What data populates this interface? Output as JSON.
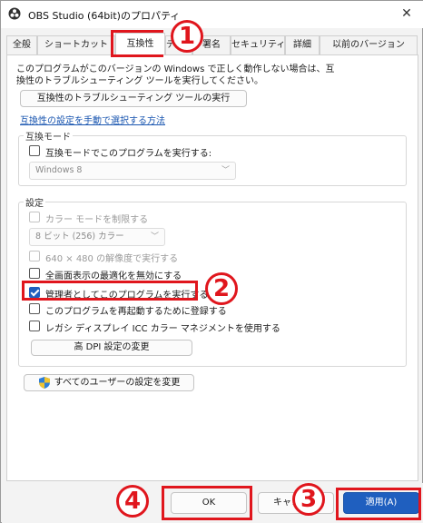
{
  "window": {
    "title": "OBS Studio (64bit)のプロパティ",
    "close_glyph": "✕"
  },
  "tabs": [
    {
      "label": "全般"
    },
    {
      "label": "ショートカット"
    },
    {
      "label": "互換性",
      "active": true
    },
    {
      "label": "セキュリティ"
    },
    {
      "label": "詳細"
    },
    {
      "label": "以前のバージョン"
    }
  ],
  "tab_partial": {
    "label_a": "デジタ",
    "label_b": "署名"
  },
  "intro": {
    "line1": "このプログラムがこのバージョンの Windows で正しく動作しない場合は、互",
    "line2": "換性のトラブルシューティング ツールを実行してください。",
    "troubleshoot_button": "互換性のトラブルシューティング ツールの実行",
    "manual_link": "互換性の設定を手動で選択する方法"
  },
  "compat_mode": {
    "group_label": "互換モード",
    "checkbox_label": "互換モードでこのプログラムを実行する:",
    "checked": false,
    "selected_os": "Windows 8"
  },
  "settings": {
    "group_label": "設定",
    "color_mode_label": "カラー モードを制限する",
    "color_select": "8 ビット (256) カラー",
    "res_640_label": "640 × 480 の解像度で実行する",
    "fullscreen_opt_label": "全画面表示の最適化を無効にする",
    "run_as_admin_label": "管理者としてこのプログラムを実行する",
    "run_as_admin_checked": true,
    "register_restart_label": "このプログラムを再起動するために登録する",
    "legacy_icc_label": "レガシ ディスプレイ ICC カラー マネジメントを使用する",
    "high_dpi_button": "高 DPI 設定の変更"
  },
  "all_users_button": "すべてのユーザーの設定を変更",
  "footer": {
    "ok": "OK",
    "cancel": "キャンセル",
    "apply": "適用(A)"
  },
  "annotations": {
    "badge1": "1",
    "badge2": "2",
    "badge3": "3",
    "badge4": "4",
    "color": "#e0161d"
  },
  "colors": {
    "accent": "#1f5fbf",
    "link": "#1a56b0",
    "highlight": "#e0161d"
  }
}
